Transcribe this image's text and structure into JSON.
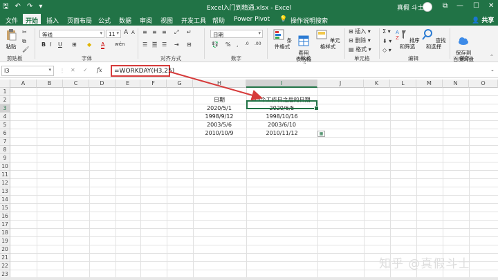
{
  "titlebar": {
    "qat_icons": [
      "save-icon",
      "undo-icon",
      "redo-icon",
      "customize-icon"
    ],
    "qat": {
      "save": "🖫",
      "undo": "↶",
      "redo": "↷",
      "more": "▾"
    },
    "title": "Excel入门到精通.xlsx  -  Excel",
    "user": "真假 斗士",
    "controls": {
      "ribbon_display": "⧉",
      "minimize": "—",
      "maximize": "☐",
      "close": "✕"
    }
  },
  "tabs": {
    "file": "文件",
    "home": "开始",
    "insert": "插入",
    "layout": "页面布局",
    "formulas": "公式",
    "data": "数据",
    "review": "审阅",
    "view": "视图",
    "developer": "开发工具",
    "help": "帮助",
    "powerpivot": "Power Pivot",
    "tell_me": "操作说明搜索",
    "share": "共享"
  },
  "ribbon": {
    "clipboard": {
      "paste": "粘贴",
      "label": "剪贴板"
    },
    "font": {
      "name": "等线",
      "size": "11",
      "bold": "B",
      "italic": "I",
      "underline": "U",
      "grow": "A",
      "shrink": "A",
      "color": "A",
      "phonetic": "wén",
      "label": "字体"
    },
    "alignment": {
      "label": "对齐方式"
    },
    "number": {
      "format": "日期",
      "label": "数字"
    },
    "styles": {
      "conditional": "条件格式",
      "table": "套用\n表格格式",
      "cell_styles": "单元格样式",
      "label": "样式"
    },
    "cells": {
      "insert": "插入",
      "delete": "删除",
      "format": "格式",
      "label": "单元格"
    },
    "editing": {
      "sort": "排序和筛选",
      "find": "查找和选择",
      "label": "编辑"
    },
    "baidu": {
      "save": "保存到\n百度网盘",
      "label": "保存"
    }
  },
  "formula_bar": {
    "name_box": "I3",
    "cancel": "✕",
    "enter": "✓",
    "fx": "fx",
    "formula": "=WORKDAY(H3,25)"
  },
  "grid": {
    "columns": [
      "A",
      "B",
      "C",
      "D",
      "E",
      "F",
      "G",
      "H",
      "I",
      "J",
      "K",
      "L",
      "M",
      "N",
      "O"
    ],
    "selected_column": "I",
    "rows": [
      "1",
      "2",
      "3",
      "4",
      "5",
      "6",
      "7",
      "8",
      "9",
      "10",
      "11",
      "12",
      "13",
      "14",
      "15",
      "16",
      "17",
      "18",
      "19",
      "20",
      "21",
      "22",
      "23"
    ],
    "selected_row": "3",
    "header_h": "日期",
    "header_i": "25个工作日之后的日期",
    "dates_h": [
      "2020/5/1",
      "1998/9/12",
      "2003/5/6",
      "2010/10/9"
    ],
    "dates_i": [
      "2020/6/5",
      "1998/10/16",
      "2003/6/10",
      "2010/11/12"
    ],
    "paste_options_icon": "paste-options-icon"
  },
  "watermark": "知乎 @真假斗士",
  "colors": {
    "excel_green": "#217346",
    "annotation_red": "#d63a3a"
  }
}
